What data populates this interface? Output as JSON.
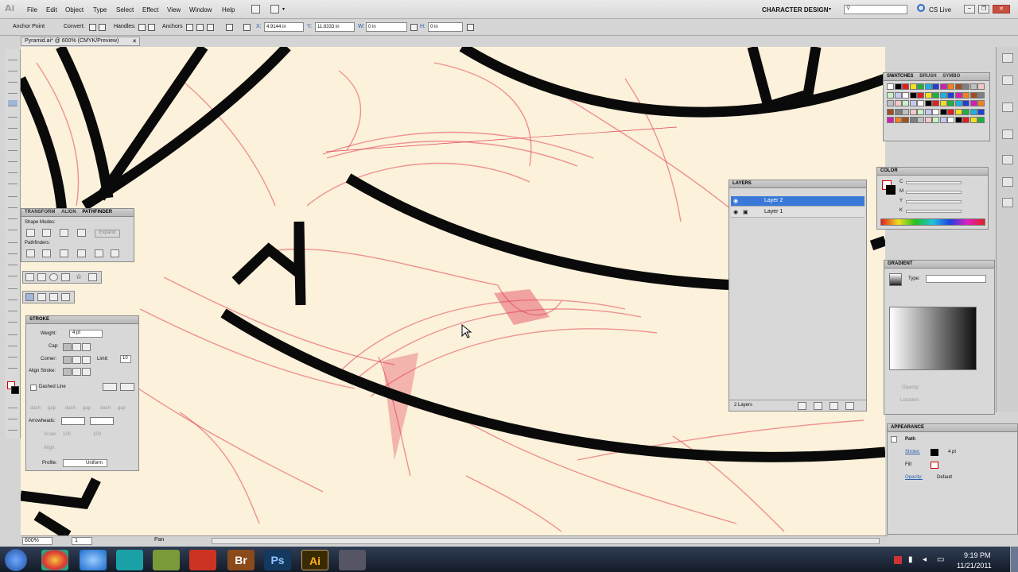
{
  "app": {
    "logo": "Ai",
    "menus": [
      "File",
      "Edit",
      "Object",
      "Type",
      "Select",
      "Effect",
      "View",
      "Window",
      "Help"
    ],
    "workspace": "CHARACTER DESIGN",
    "search_placeholder": "",
    "cslive": "CS Live"
  },
  "control_bar": {
    "mode_label": "Anchor Point",
    "convert_label": "Convert:",
    "handles_label": "Handles:",
    "anchors_label": "Anchors",
    "x_label": "X:",
    "x_value": "4.9144 in",
    "y_label": "Y:",
    "y_value": "11.8333 in",
    "w_label": "W:",
    "w_value": "0 in",
    "h_label": "H:",
    "h_value": "0 in"
  },
  "document": {
    "tab_title": "Pyramid.ai* @ 600% (CMYK/Preview)",
    "zoom": "600%",
    "page": "1",
    "status": "Pan"
  },
  "panels": {
    "transform": {
      "tabs": [
        "TRANSFORM",
        "ALIGN",
        "PATHFINDER"
      ],
      "shape_modes": "Shape Modes:",
      "expand": "Expand",
      "pathfinders": "Pathfinders:"
    },
    "stroke": {
      "title": "STROKE",
      "weight_label": "Weight:",
      "weight_value": "4 pt",
      "cap_label": "Cap:",
      "corner_label": "Corner:",
      "limit_label": "Limit:",
      "limit_value": "10",
      "align_label": "Align Stroke:",
      "dashed": "Dashed Line",
      "dash_labels": [
        "dash",
        "gap",
        "dash",
        "gap",
        "dash",
        "gap"
      ],
      "arrowheads": "Arrowheads:",
      "scale": "Scale:",
      "scale_values": [
        "100",
        "100"
      ],
      "align_arrow": "Align:",
      "profile": "Profile:",
      "profile_value": "Uniform"
    },
    "layers": {
      "title": "LAYERS",
      "rows": [
        "Layer 2",
        "Layer 1"
      ],
      "footer": "2 Layers"
    },
    "swatches": {
      "tabs": [
        "SWATCHES",
        "BRUSH",
        "SYMBO"
      ]
    },
    "color": {
      "title": "COLOR",
      "channels": [
        "C",
        "M",
        "Y",
        "K"
      ]
    },
    "gradient": {
      "title": "GRADIENT",
      "type_label": "Type:",
      "opacity": "Opacity:",
      "location": "Location:"
    },
    "appearance": {
      "title": "APPEARANCE",
      "object": "Path",
      "stroke_label": "Stroke:",
      "stroke_value": "4 pt",
      "fill_label": "Fill:",
      "opacity_label": "Opacity:",
      "opacity_value": "Default"
    }
  },
  "taskbar": {
    "time": "9:19 PM",
    "date": "11/21/2011",
    "apps": [
      "Br",
      "Ps",
      "Ai"
    ]
  },
  "colors": {
    "sketch_red": "#e2415a",
    "ink": "#0a0a0a",
    "paper": "#fcf1da",
    "selection_blue": "#3a79d8"
  }
}
